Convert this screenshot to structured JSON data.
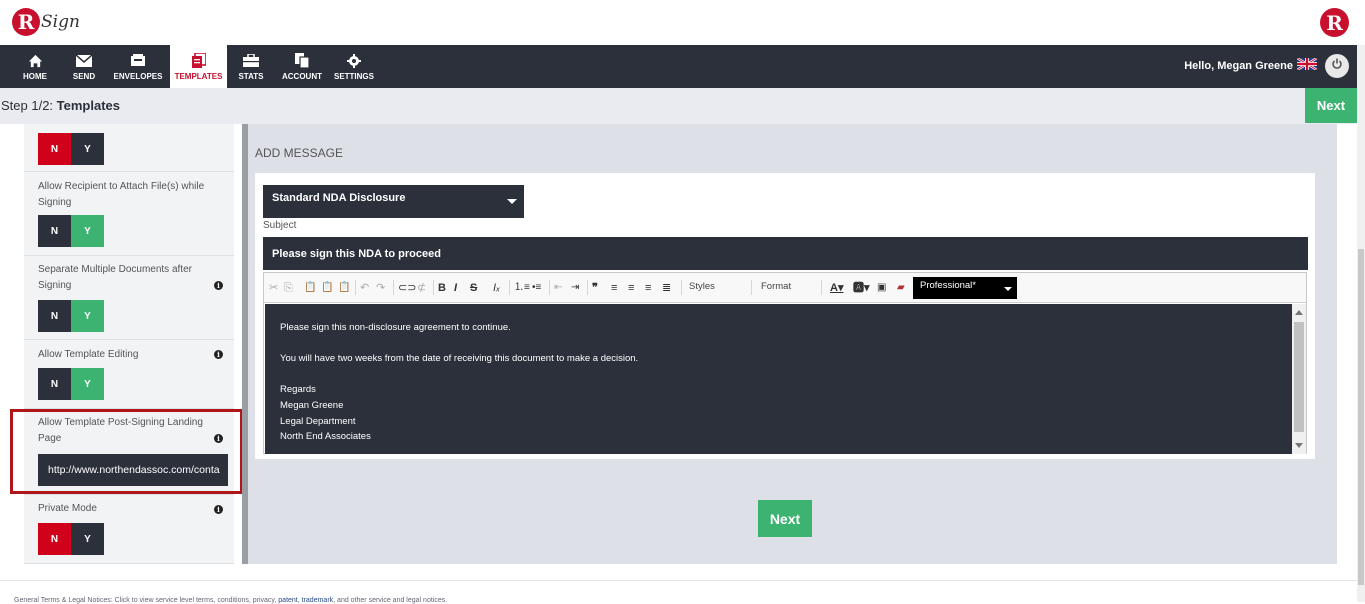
{
  "brand": {
    "logo_letter": "R",
    "logo_word": "Sign",
    "right_logo_letter": "R",
    "accent": "#c8102e",
    "nav_bg": "#2b303b",
    "green": "#3cb371"
  },
  "nav": {
    "items": [
      {
        "label": "HOME",
        "icon": "home-icon"
      },
      {
        "label": "SEND",
        "icon": "envelope-icon"
      },
      {
        "label": "ENVELOPES",
        "icon": "inbox-icon"
      },
      {
        "label": "TEMPLATES",
        "icon": "template-icon",
        "active": true
      },
      {
        "label": "STATS",
        "icon": "briefcase-icon"
      },
      {
        "label": "ACCOUNT",
        "icon": "documents-icon"
      },
      {
        "label": "SETTINGS",
        "icon": "gear-icon"
      }
    ],
    "greeting": "Hello, Megan Greene",
    "flag_icon": "uk-flag-icon",
    "power_icon": "power-icon"
  },
  "step": {
    "prefix": "Step 1/2: ",
    "title": "Templates",
    "next_label": "Next"
  },
  "settings": {
    "top_toggle": {
      "no": "N",
      "yes": "Y",
      "selected": "N"
    },
    "attach": {
      "label": "Allow Recipient to Attach File(s) while Signing",
      "no": "N",
      "yes": "Y",
      "selected": "Y"
    },
    "separate": {
      "label": "Separate Multiple Documents after Signing",
      "no": "N",
      "yes": "Y",
      "selected": "Y",
      "info": "i"
    },
    "editing": {
      "label": "Allow Template Editing",
      "no": "N",
      "yes": "Y",
      "selected": "Y",
      "info": "i"
    },
    "landing": {
      "label": "Allow Template Post-Signing Landing Page",
      "value": "http://www.northendassoc.com/conta",
      "info": "i"
    },
    "private": {
      "label": "Private Mode",
      "no": "N",
      "yes": "Y",
      "selected": "N",
      "info": "i"
    }
  },
  "message": {
    "heading": "ADD MESSAGE",
    "template_select": "Standard NDA Disclosure",
    "subject_label": "Subject",
    "subject_value": "Please sign this NDA to proceed",
    "toolbar": {
      "styles": "Styles",
      "format": "Format",
      "font": "Professional*"
    },
    "body": {
      "line1": "Please sign this non-disclosure agreement to continue.",
      "line2": "You will have two weeks from the date of receiving this document to make a decision.",
      "line3": "Regards",
      "line4": "Megan Greene",
      "line5": "Legal Department",
      "line6": "North End Associates"
    },
    "next_label": "Next"
  },
  "footer": {
    "prefix": "General Terms & Legal Notices: Click to view service level terms, conditions, privacy, ",
    "link1": "patent",
    "link2": "trademark",
    "suffix": ", and other service and legal notices."
  }
}
